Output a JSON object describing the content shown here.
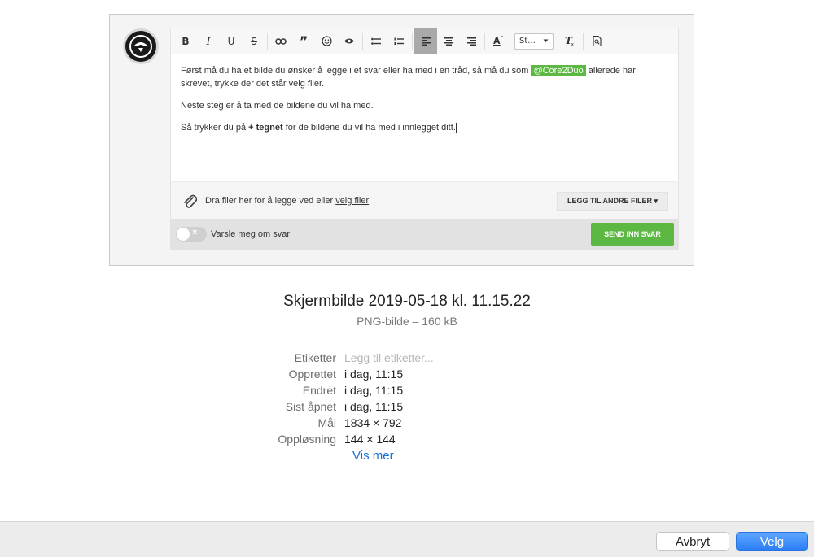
{
  "preview": {
    "toolbar": {
      "bold": "B",
      "italic": "I",
      "underline": "U",
      "strike": "S",
      "quote": "”",
      "style_select": "St...",
      "clear_format": "Tx"
    },
    "body": {
      "p1_before": "Først må du ha et bilde du ønsker å legge i et svar eller ha med i en tråd, så må du som ",
      "p1_mention": "@Core2Duo",
      "p1_after": " allerede har skrevet, trykke der det står velg filer.",
      "p2": "Neste steg er å ta med de bildene du vil ha med.",
      "p3_before": "Så trykker du på ",
      "p3_bold": "+ tegnet",
      "p3_after": " for de bildene du vil ha med i innlegget ditt."
    },
    "dropzone": {
      "text": "Dra filer her for å legge ved eller ",
      "link": "velg filer",
      "add_button": "LEGG TIL ANDRE FILER ▾"
    },
    "footer": {
      "toggle_label": "Varsle meg om svar",
      "send_button": "SEND INN SVAR"
    },
    "colors": {
      "accent_green": "#5db843"
    }
  },
  "file": {
    "title": "Skjermbilde 2019-05-18 kl. 11.15.22",
    "subtitle": "PNG-bilde – 160 kB",
    "meta": [
      {
        "key": "Etiketter",
        "value": "Legg til etiketter..."
      },
      {
        "key": "Opprettet",
        "value": "i dag, 11:15"
      },
      {
        "key": "Endret",
        "value": "i dag, 11:15"
      },
      {
        "key": "Sist åpnet",
        "value": "i dag, 11:15"
      },
      {
        "key": "Mål",
        "value": "1834 × 792"
      },
      {
        "key": "Oppløsning",
        "value": "144 × 144"
      }
    ],
    "show_more": "Vis mer"
  },
  "dialog": {
    "cancel": "Avbryt",
    "ok": "Velg",
    "accent_blue": "#2a7df5"
  }
}
